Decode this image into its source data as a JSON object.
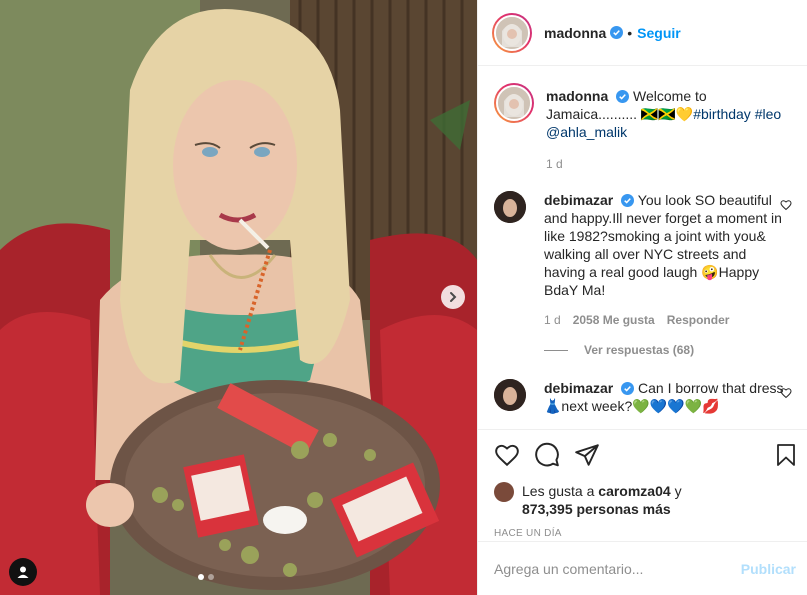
{
  "header": {
    "username": "madonna",
    "separator": "•",
    "follow_label": "Seguir"
  },
  "caption": {
    "username": "madonna",
    "text_line1": "Welcome to Jamaica..........",
    "flags": "🇯🇲🇯🇲💛",
    "hashtags": "#birthday #leo @ahla_malik",
    "age": "1 d"
  },
  "comments": [
    {
      "username": "debimazar",
      "text": "You look SO beautiful and happy.Ill never forget a moment in like 1982?smoking a joint with you& walking all over NYC streets and having a real good laugh 🤪Happy BdaY Ma!",
      "age": "1 d",
      "likes": "2058 Me gusta",
      "reply_label": "Responder",
      "view_replies": "Ver respuestas (68)"
    },
    {
      "username": "debimazar",
      "text": "Can I borrow that dress 👗next week?💚💙💙💚💋"
    }
  ],
  "likes": {
    "prefix": "Les gusta a",
    "user": "caromza04",
    "joiner": "y",
    "others": "873,395 personas más"
  },
  "timestamp": "HACE UN DÍA",
  "add_comment": {
    "placeholder": "Agrega un comentario...",
    "publish_label": "Publicar"
  },
  "colors": {
    "link_blue": "#0095f6",
    "publish_disabled": "#b2dffc",
    "verified_blue": "#3897f0",
    "muted_text": "#8e8e8e"
  },
  "icons": [
    "heart-icon",
    "comment-icon",
    "share-icon",
    "bookmark-icon",
    "chevron-right-icon",
    "user-tag-icon",
    "verified-badge-icon"
  ]
}
